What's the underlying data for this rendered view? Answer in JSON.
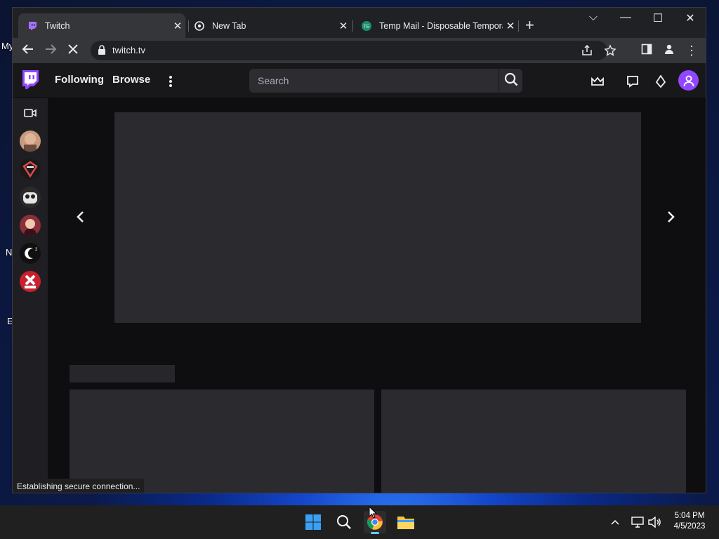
{
  "desktop": {
    "label_my": "My",
    "label_n": "N",
    "label_e": "E"
  },
  "tabs": [
    {
      "title": "Twitch",
      "active": true
    },
    {
      "title": "New Tab",
      "active": false
    },
    {
      "title": "Temp Mail - Disposable Tempora",
      "active": false
    }
  ],
  "toolbar": {
    "url": "twitch.tv"
  },
  "twitch": {
    "nav_following": "Following",
    "nav_browse": "Browse",
    "search_placeholder": "Search"
  },
  "status_text": "Establishing secure connection...",
  "clock": {
    "time": "5:04 PM",
    "date": "4/5/2023"
  },
  "colors": {
    "twitch_purple": "#9147ff",
    "window_bg": "#202124",
    "page_bg": "#0e0e10"
  }
}
